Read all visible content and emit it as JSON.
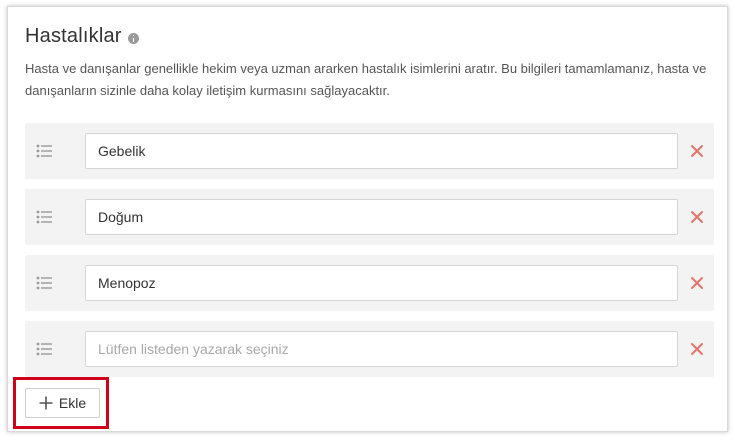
{
  "section": {
    "title": "Hastalıklar",
    "description": "Hasta ve danışanlar genellikle hekim veya uzman ararken hastalık isimlerini aratır. Bu bilgileri tamamlamanız, hasta ve danışanların sizinle daha kolay iletişim kurmasını sağlayacaktır."
  },
  "items": [
    {
      "value": "Gebelik",
      "placeholder": ""
    },
    {
      "value": "Doğum",
      "placeholder": ""
    },
    {
      "value": "Menopoz",
      "placeholder": ""
    },
    {
      "value": "",
      "placeholder": "Lütfen listeden yazarak seçiniz"
    }
  ],
  "add_button": {
    "label": "Ekle"
  },
  "colors": {
    "remove_icon": "#e8736a",
    "highlight_border": "#d0021b",
    "row_background": "#f3f3f3"
  },
  "icons": {
    "title": "info-icon",
    "row_handle": "drag-handle-icon",
    "row_remove": "close-icon",
    "add": "plus-icon"
  }
}
